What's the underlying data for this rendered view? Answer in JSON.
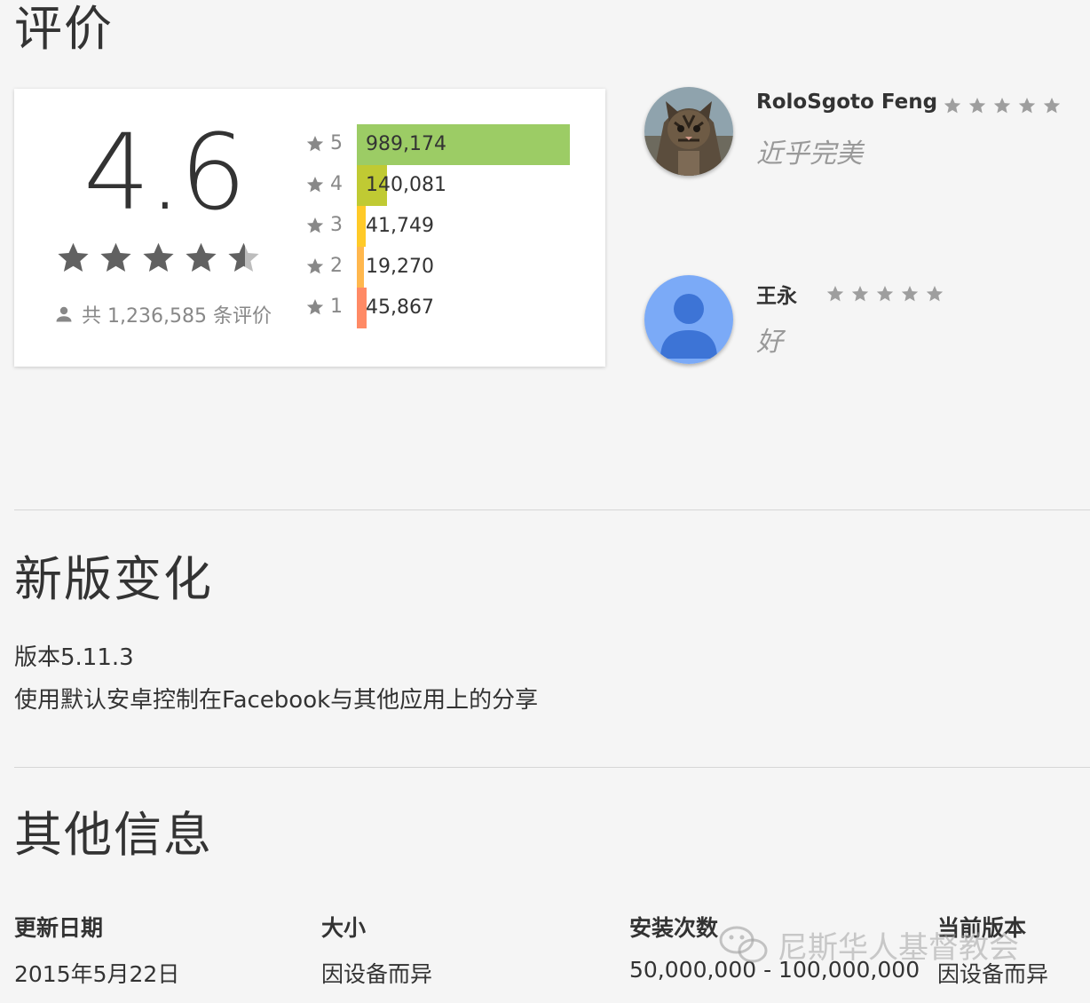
{
  "reviews_section": {
    "title": "评价",
    "average_rating": "4.6",
    "total_label": "共 1,236,585 条评价",
    "histogram": [
      {
        "star": "5",
        "count": "989,174",
        "fraction": 0.8,
        "color": "#9ccc65"
      },
      {
        "star": "4",
        "count": "140,081",
        "fraction": 0.113,
        "color": "#c0ca33"
      },
      {
        "star": "3",
        "count": "41,749",
        "fraction": 0.034,
        "color": "#ffca28"
      },
      {
        "star": "2",
        "count": "19,270",
        "fraction": 0.016,
        "color": "#ffb74d"
      },
      {
        "star": "1",
        "count": "45,867",
        "fraction": 0.037,
        "color": "#ff8a65"
      }
    ],
    "reviews": [
      {
        "name": "RoloSgoto Feng",
        "text": "近乎完美",
        "stars": 5,
        "avatar": "cat-photo"
      },
      {
        "name": "王永",
        "text": "好",
        "stars": 5,
        "avatar": "default-user"
      }
    ]
  },
  "changes_section": {
    "title": "新版变化",
    "version": "版本5.11.3",
    "description": "使用默认安卓控制在Facebook与其他应用上的分享"
  },
  "info_section": {
    "title": "其他信息",
    "items": [
      {
        "label": "更新日期",
        "value": "2015年5月22日"
      },
      {
        "label": "大小",
        "value": "因设备而异"
      },
      {
        "label": "安装次数",
        "value": "50,000,000 - 100,000,000"
      },
      {
        "label": "当前版本",
        "value": "因设备而异"
      }
    ]
  },
  "watermark": {
    "text": "尼斯华人基督教会",
    "icon": "wechat-icon"
  },
  "colors": {
    "star_dark": "#616161",
    "star_light": "#9e9e9e",
    "star_grey": "#888888",
    "avatar_blue": "#7baaf7",
    "avatar_dark_blue": "#3d74d6"
  }
}
